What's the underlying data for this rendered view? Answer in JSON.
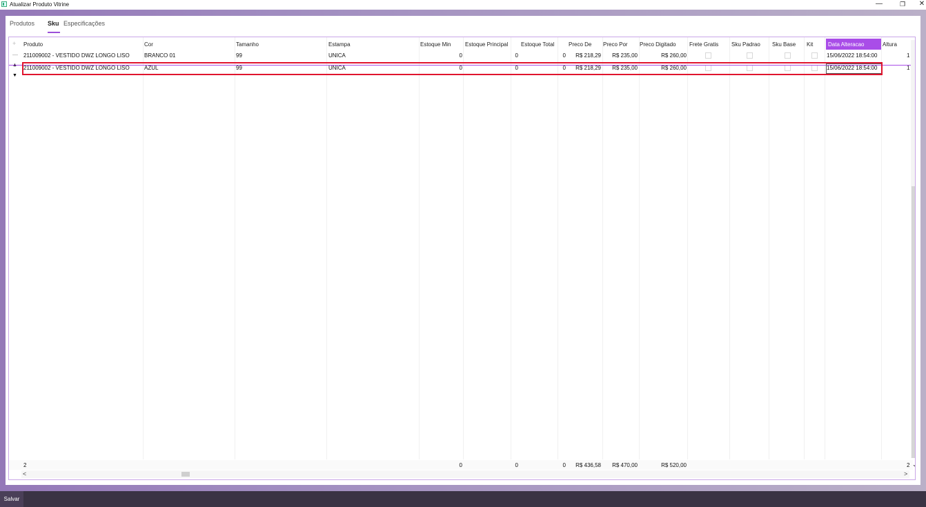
{
  "window": {
    "title": "Atualizar Produto Vitrine",
    "minimize_glyph": "—",
    "restore_glyph": "❐",
    "close_glyph": "✕"
  },
  "tabs": [
    {
      "label": "Produtos",
      "active": false
    },
    {
      "label": "Sku",
      "active": true
    },
    {
      "label": "Especificações",
      "active": false
    }
  ],
  "accent_color": "#a94de8",
  "highlight_color": "#e0142e",
  "grid": {
    "add_glyph": "+",
    "columns": [
      {
        "key": "produto",
        "label": "Produto"
      },
      {
        "key": "cor",
        "label": "Cor"
      },
      {
        "key": "tamanho",
        "label": "Tamanho"
      },
      {
        "key": "estampa",
        "label": "Estampa"
      },
      {
        "key": "estoque_min",
        "label": "Estoque Min"
      },
      {
        "key": "estoque_principal",
        "label": "Estoque Principal"
      },
      {
        "key": "estoque_total",
        "label": "Estoque Total"
      },
      {
        "key": "preco_de",
        "label": "Preco De"
      },
      {
        "key": "preco_por",
        "label": "Preco Por"
      },
      {
        "key": "preco_digitado",
        "label": "Preco Digitado"
      },
      {
        "key": "frete_gratis",
        "label": "Frete Gratis"
      },
      {
        "key": "sku_padrao",
        "label": "Sku Padrao"
      },
      {
        "key": "sku_base",
        "label": "Sku Base"
      },
      {
        "key": "kit",
        "label": "Kit"
      },
      {
        "key": "data_alteracao",
        "label": "Data Alteracao"
      },
      {
        "key": "altura",
        "label": "Altura"
      }
    ],
    "rows": [
      {
        "marker": "—",
        "produto": "211009002 - VESTIDO DWZ LONGO LISO",
        "cor": "BRANCO 01",
        "tamanho": "99",
        "estampa": "UNICA",
        "estoque_min": "0",
        "estoque_principal": "0",
        "estoque_total": "0",
        "preco_de": "R$ 218,29",
        "preco_por": "R$ 235,00",
        "preco_digitado": "R$ 260,00",
        "data_alteracao": "15/06/2022 18:54:00",
        "altura": "1"
      },
      {
        "marker": "▲",
        "produto": "211009002 - VESTIDO DWZ LONGO LISO",
        "cor": "AZUL",
        "tamanho": "99",
        "estampa": "UNICA",
        "estoque_min": "0",
        "estoque_principal": "0",
        "estoque_total": "0",
        "preco_de": "R$ 218,29",
        "preco_por": "R$ 235,00",
        "preco_digitado": "R$ 260,00",
        "data_alteracao": "15/06/2022 18:54:00",
        "altura": "1"
      }
    ],
    "new_row_marker": "▼",
    "footer": {
      "count": "2",
      "estoque_min": "0",
      "estoque_principal": "0",
      "estoque_total": "0",
      "preco_de": "R$ 436,58",
      "preco_por": "R$ 470,00",
      "preco_digitado": "R$ 520,00",
      "altura": "2"
    },
    "scroll": {
      "left_arrow": "<",
      "right_arrow": ">",
      "down_arrow": "⌄"
    }
  },
  "actions": {
    "save_label": "Salvar"
  }
}
